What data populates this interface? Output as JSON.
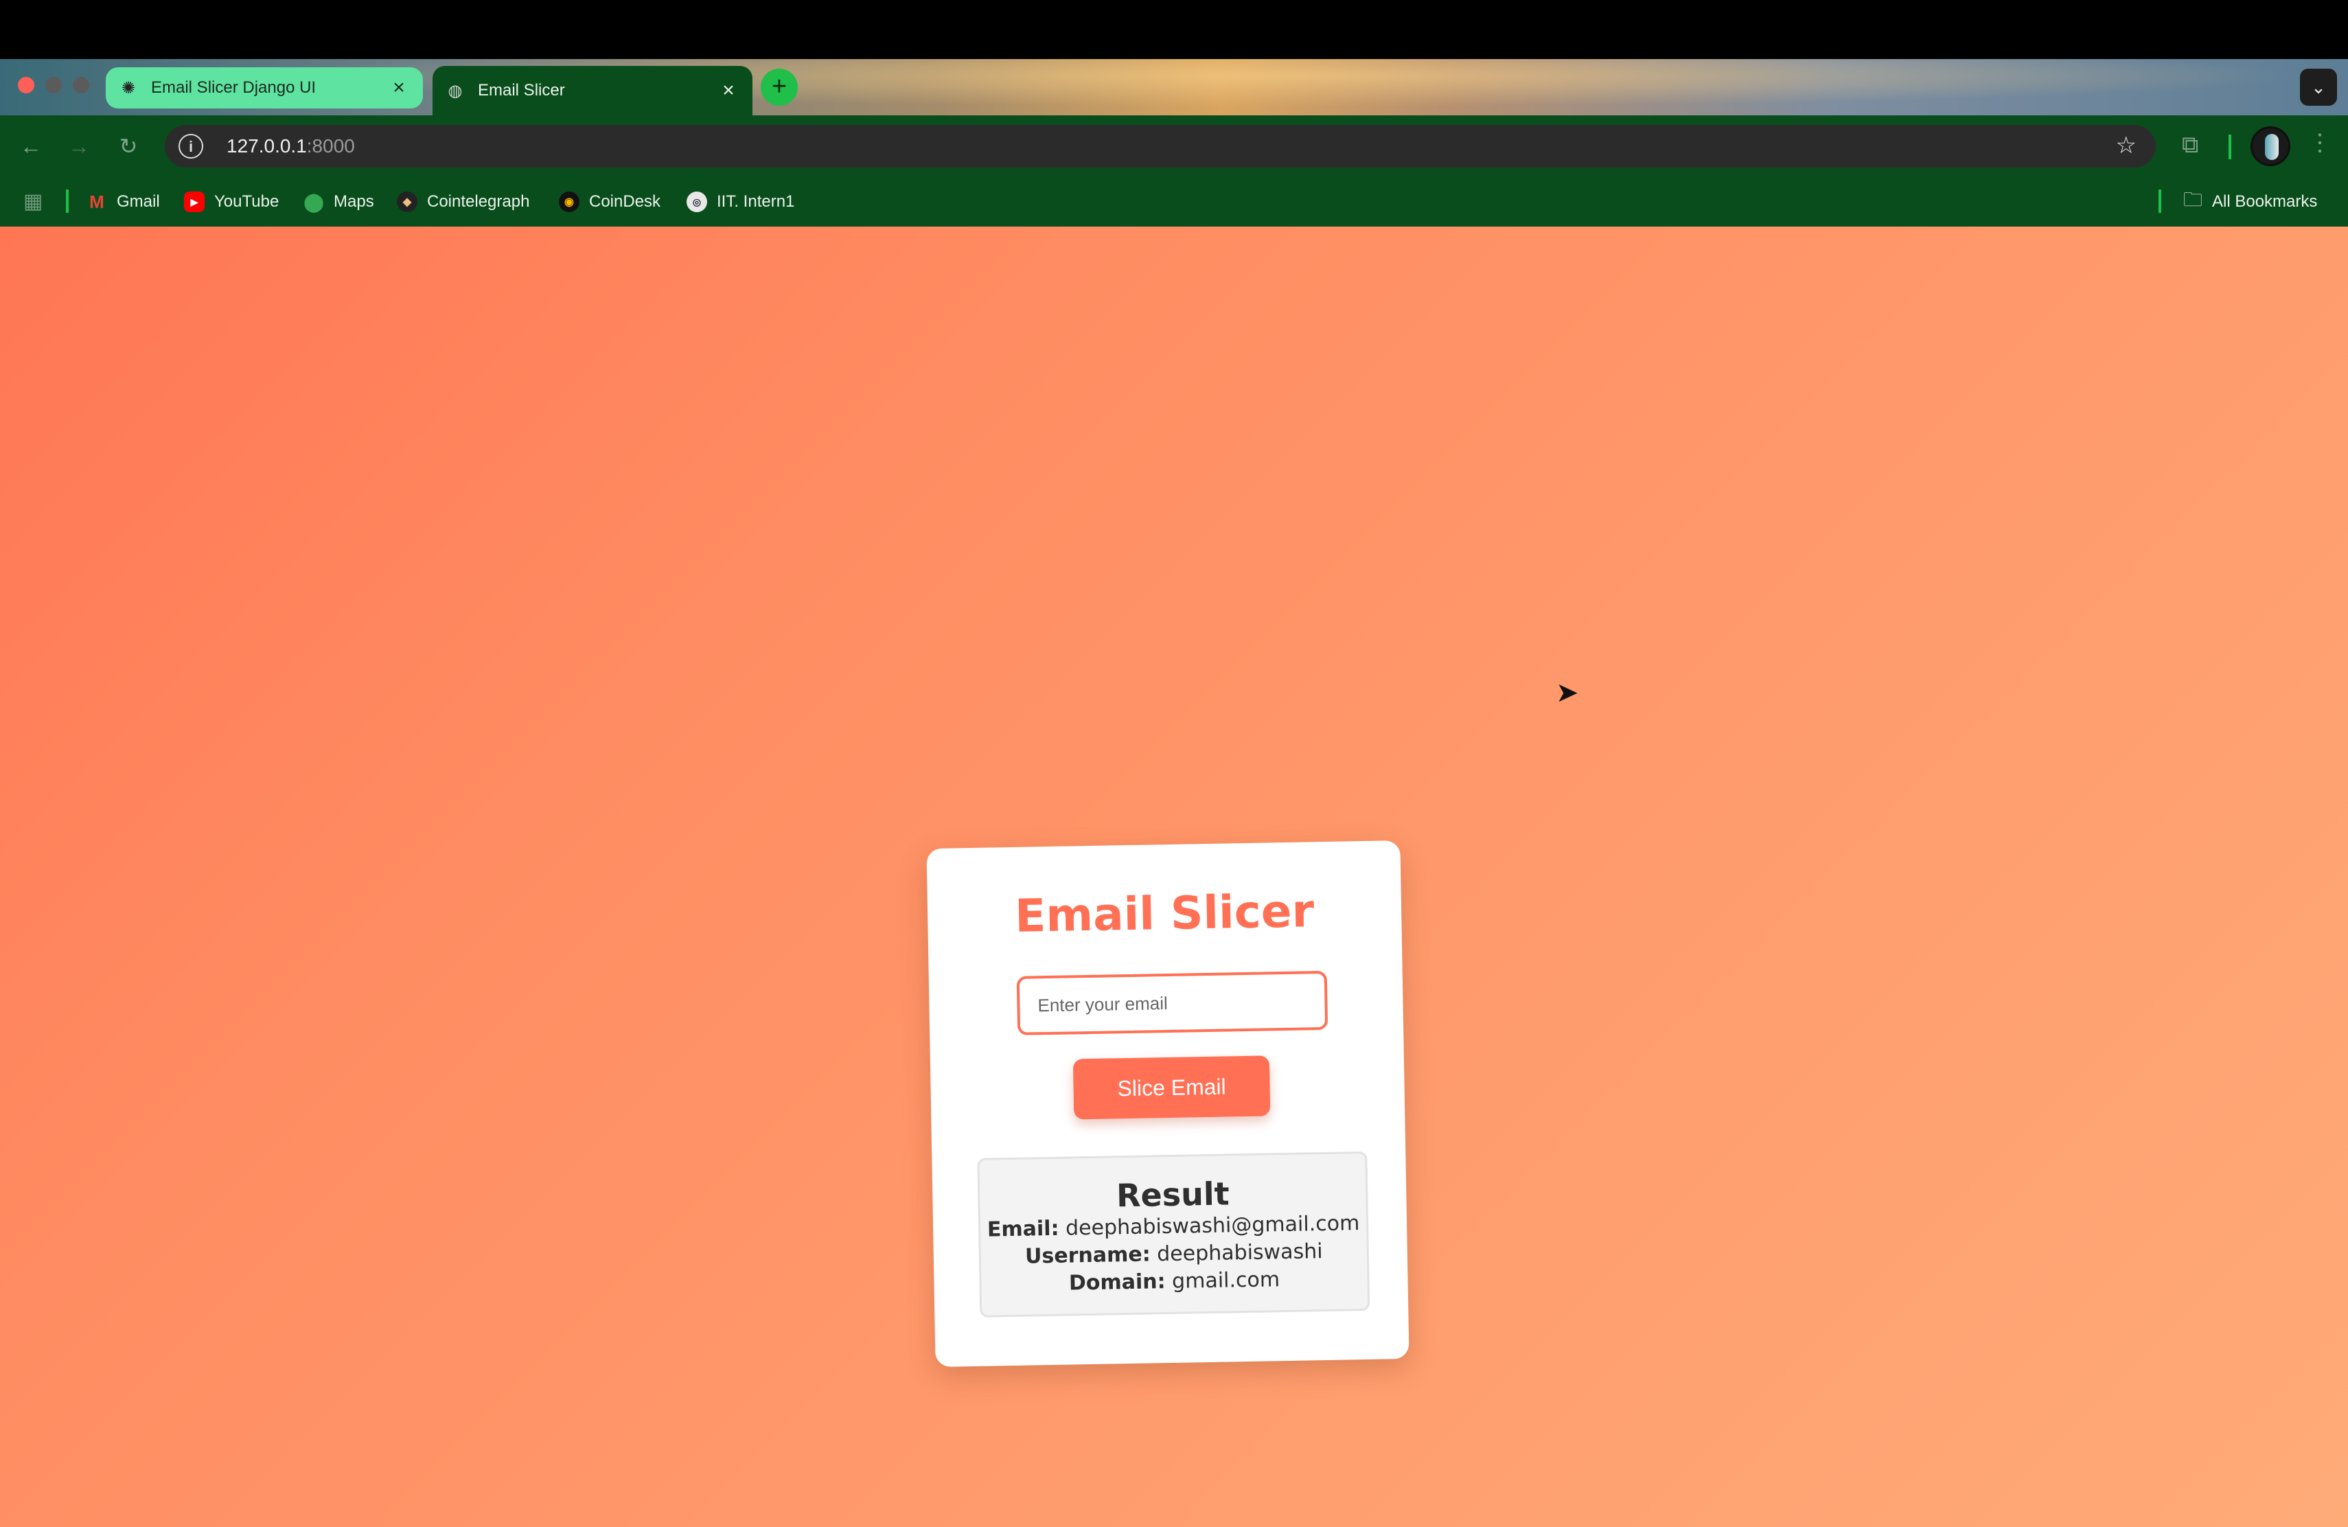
{
  "browser": {
    "tabs": [
      {
        "title": "Email Slicer Django UI",
        "active": false
      },
      {
        "title": "Email Slicer",
        "active": true
      }
    ],
    "new_tab_symbol": "+",
    "tab_search_symbol": "⌄",
    "url_host": "127.0.0.1",
    "url_port": ":8000",
    "bookmarks": [
      {
        "label": "Gmail",
        "icon": "gmail-icon"
      },
      {
        "label": "YouTube",
        "icon": "youtube-icon"
      },
      {
        "label": "Maps",
        "icon": "maps-icon"
      },
      {
        "label": "Cointelegraph",
        "icon": "cointelegraph-icon"
      },
      {
        "label": "CoinDesk",
        "icon": "coindesk-icon"
      },
      {
        "label": "IIT. Intern1",
        "icon": "iit-icon"
      }
    ],
    "all_bookmarks_label": "All Bookmarks",
    "colors": {
      "toolbar": "#0a4d1d",
      "active_tab_accent": "#5fe3a0",
      "new_tab_button": "#1fbf4a"
    }
  },
  "app": {
    "title": "Email Slicer",
    "input_placeholder": "Enter your email",
    "input_value": "",
    "button_label": "Slice Email",
    "result": {
      "heading": "Result",
      "email_label": "Email:",
      "email_value": "deephabiswashi@gmail.com",
      "username_label": "Username:",
      "username_value": "deephabiswashi",
      "domain_label": "Domain:",
      "domain_value": "gmail.com"
    },
    "colors": {
      "accent": "#ff7055",
      "background_start": "#ff7654",
      "background_end": "#ffab78"
    }
  }
}
